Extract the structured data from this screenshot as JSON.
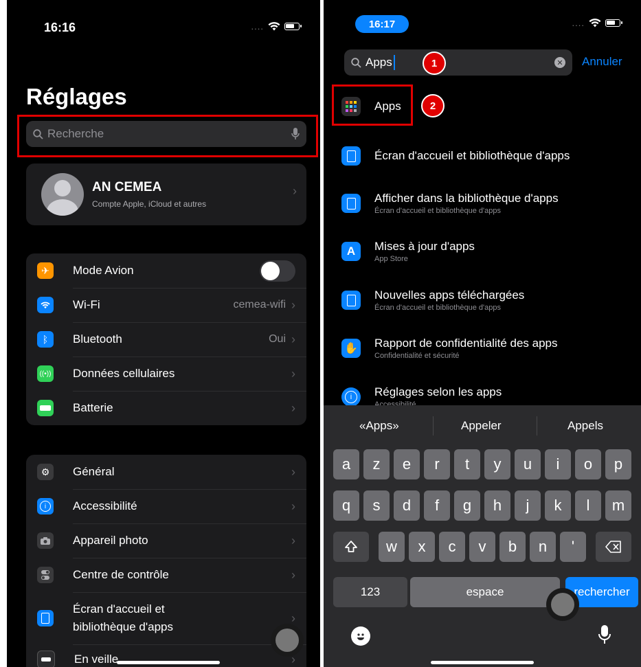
{
  "left": {
    "status": {
      "time": "16:16",
      "dots": "...."
    },
    "title": "Réglages",
    "search_placeholder": "Recherche",
    "account": {
      "name": "AN CEMEA",
      "subtitle": "Compte Apple, iCloud et autres"
    },
    "group1": [
      {
        "label": "Mode Avion",
        "icon": "airplane-icon",
        "color": "#ff9500",
        "value": "",
        "toggle": true
      },
      {
        "label": "Wi-Fi",
        "icon": "wifi-icon",
        "color": "#0a84ff",
        "value": "cemea-wifi"
      },
      {
        "label": "Bluetooth",
        "icon": "bluetooth-icon",
        "color": "#0a84ff",
        "value": "Oui"
      },
      {
        "label": "Données cellulaires",
        "icon": "antenna-icon",
        "color": "#30d158",
        "value": ""
      },
      {
        "label": "Batterie",
        "icon": "battery-icon",
        "color": "#30d158",
        "value": ""
      }
    ],
    "group2": [
      {
        "label": "Général",
        "icon": "gear-icon",
        "color": "#8e8e93"
      },
      {
        "label": "Accessibilité",
        "icon": "accessibility-icon",
        "color": "#0a84ff"
      },
      {
        "label": "Appareil photo",
        "icon": "camera-icon",
        "color": "#8e8e93"
      },
      {
        "label": "Centre de contrôle",
        "icon": "switches-icon",
        "color": "#8e8e93"
      },
      {
        "label_line1": "Écran d'accueil et",
        "label_line2": "bibliothèque d'apps",
        "icon": "home-screen-icon",
        "color": "#0a84ff"
      },
      {
        "label": "En veille",
        "icon": "standby-icon",
        "color": "#2c2c2e"
      }
    ]
  },
  "right": {
    "status": {
      "time": "16:17",
      "dots": "...."
    },
    "search_value": "Apps",
    "cancel_label": "Annuler",
    "badges": [
      "1",
      "2"
    ],
    "results": [
      {
        "title": "Apps",
        "subtitle": "",
        "icon": "apps-grid-icon"
      },
      {
        "title": "Écran d'accueil et bibliothèque d'apps",
        "subtitle": "",
        "icon": "home-screen-icon"
      },
      {
        "title": "Afficher dans la bibliothèque d'apps",
        "subtitle": "Écran d'accueil et bibliothèque d'apps",
        "icon": "home-screen-icon"
      },
      {
        "title": "Mises à jour d'apps",
        "subtitle": "App Store",
        "icon": "app-store-icon"
      },
      {
        "title": "Nouvelles apps téléchargées",
        "subtitle": "Écran d'accueil et bibliothèque d'apps",
        "icon": "home-screen-icon"
      },
      {
        "title": "Rapport de confidentialité des apps",
        "subtitle": "Confidentialité et sécurité",
        "icon": "privacy-hand-icon"
      },
      {
        "title": "Réglages selon les apps",
        "subtitle": "Accessibilité",
        "icon": "accessibility-icon"
      }
    ],
    "suggestions": [
      "«Apps»",
      "Appeler",
      "Appels"
    ],
    "keys_row1": [
      "a",
      "z",
      "e",
      "r",
      "t",
      "y",
      "u",
      "i",
      "o",
      "p"
    ],
    "keys_row2": [
      "q",
      "s",
      "d",
      "f",
      "g",
      "h",
      "j",
      "k",
      "l",
      "m"
    ],
    "keys_row3": [
      "w",
      "x",
      "c",
      "v",
      "b",
      "n",
      "'"
    ],
    "key_123": "123",
    "key_space": "espace",
    "key_search": "rechercher"
  }
}
